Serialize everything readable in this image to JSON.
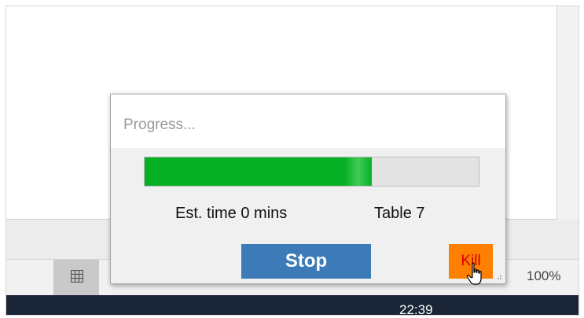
{
  "dialog": {
    "title": "Progress...",
    "progress": 0.68,
    "est_time": "Est. time 0 mins",
    "table": "Table 7",
    "stop_label": "Stop",
    "kill_label": "Kill"
  },
  "status_bar": {
    "zoom": "100%"
  },
  "taskbar": {
    "clock": "22:39"
  },
  "colors": {
    "progress_fill": "#06b025",
    "stop_button": "#3d7ab8",
    "kill_button": "#ff7f00",
    "kill_text": "#d40000",
    "taskbar": "#1b2538"
  },
  "icons": {
    "view_normal": "grid-icon",
    "cursor": "hand-pointer-icon"
  }
}
